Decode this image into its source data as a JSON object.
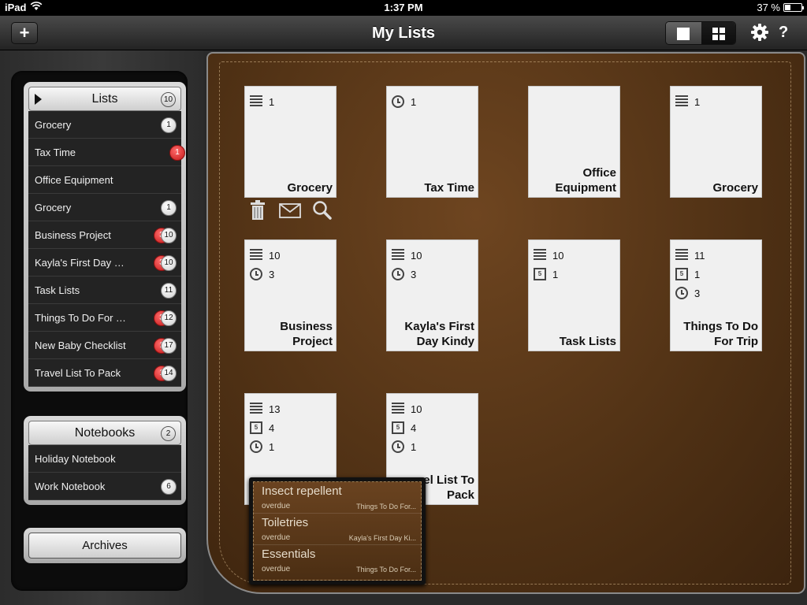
{
  "status_bar": {
    "device": "iPad",
    "time": "1:37 PM",
    "battery": "37 %",
    "battery_level": 0.37
  },
  "toolbar": {
    "title": "My Lists",
    "add_label": "+",
    "help_label": "?"
  },
  "sidebar": {
    "lists_header": "Lists",
    "lists_count": "10",
    "lists": [
      {
        "label": "Grocery",
        "count": "1",
        "overdue": ""
      },
      {
        "label": "Tax Time",
        "count": "",
        "overdue": "1"
      },
      {
        "label": "Office Equipment",
        "count": "",
        "overdue": ""
      },
      {
        "label": "Grocery",
        "count": "1",
        "overdue": ""
      },
      {
        "label": "Business Project",
        "count": "10",
        "overdue": "3"
      },
      {
        "label": "Kayla's First Day Kindy",
        "count": "10",
        "overdue": "3"
      },
      {
        "label": "Task Lists",
        "count": "11",
        "overdue": ""
      },
      {
        "label": "Things To Do For Trip",
        "count": "12",
        "overdue": "3"
      },
      {
        "label": "New Baby Checklist",
        "count": "17",
        "overdue": "1"
      },
      {
        "label": "Travel List To Pack",
        "count": "14",
        "overdue": "1"
      }
    ],
    "notebooks_header": "Notebooks",
    "notebooks_count": "2",
    "notebooks": [
      {
        "label": "Holiday Notebook",
        "count": ""
      },
      {
        "label": "Work Notebook",
        "count": "6"
      }
    ],
    "archives_label": "Archives"
  },
  "cards": [
    {
      "title_lines": [
        "Grocery"
      ],
      "stats": [
        {
          "icon": "list-lines-icon",
          "value": "1"
        }
      ]
    },
    {
      "title_lines": [
        "Tax Time"
      ],
      "stats": [
        {
          "icon": "alarm-clock-icon",
          "value": "1"
        }
      ]
    },
    {
      "title_lines": [
        "Office",
        "Equipment"
      ],
      "stats": []
    },
    {
      "title_lines": [
        "Grocery"
      ],
      "stats": [
        {
          "icon": "list-lines-icon",
          "value": "1"
        }
      ]
    },
    {
      "title_lines": [
        "Business",
        "Project"
      ],
      "stats": [
        {
          "icon": "list-lines-icon",
          "value": "10"
        },
        {
          "icon": "alarm-clock-icon",
          "value": "3"
        }
      ]
    },
    {
      "title_lines": [
        "Kayla's First",
        "Day Kindy"
      ],
      "stats": [
        {
          "icon": "list-lines-icon",
          "value": "10"
        },
        {
          "icon": "alarm-clock-icon",
          "value": "3"
        }
      ]
    },
    {
      "title_lines": [
        "Task Lists"
      ],
      "stats": [
        {
          "icon": "list-lines-icon",
          "value": "10"
        },
        {
          "icon": "calendar-icon",
          "value": "1"
        }
      ]
    },
    {
      "title_lines": [
        "Things To Do",
        "For Trip"
      ],
      "stats": [
        {
          "icon": "list-lines-icon",
          "value": "11"
        },
        {
          "icon": "calendar-icon",
          "value": "1"
        },
        {
          "icon": "alarm-clock-icon",
          "value": "3"
        }
      ]
    },
    {
      "title_lines": [],
      "stats": [
        {
          "icon": "list-lines-icon",
          "value": "13"
        },
        {
          "icon": "calendar-icon",
          "value": "4"
        },
        {
          "icon": "alarm-clock-icon",
          "value": "1"
        }
      ]
    },
    {
      "title_lines": [
        "el List To",
        "Pack"
      ],
      "stats": [
        {
          "icon": "list-lines-icon",
          "value": "10"
        },
        {
          "icon": "calendar-icon",
          "value": "4"
        },
        {
          "icon": "alarm-clock-icon",
          "value": "1"
        }
      ]
    }
  ],
  "calendar_icon_glyph": "5",
  "card_actions": [
    "trash-icon",
    "mail-icon",
    "search-icon"
  ],
  "overdue_popup": [
    {
      "title": "Insect repellent",
      "status": "overdue",
      "list": "Things To Do For..."
    },
    {
      "title": "Toiletries",
      "status": "overdue",
      "list": "Kayla's First Day Ki..."
    },
    {
      "title": "Essentials",
      "status": "overdue",
      "list": "Things To Do For..."
    }
  ],
  "colors": {
    "leather": "#5a3818",
    "overdue_badge": "#d42020",
    "toolbar": "#2e2e2e"
  }
}
